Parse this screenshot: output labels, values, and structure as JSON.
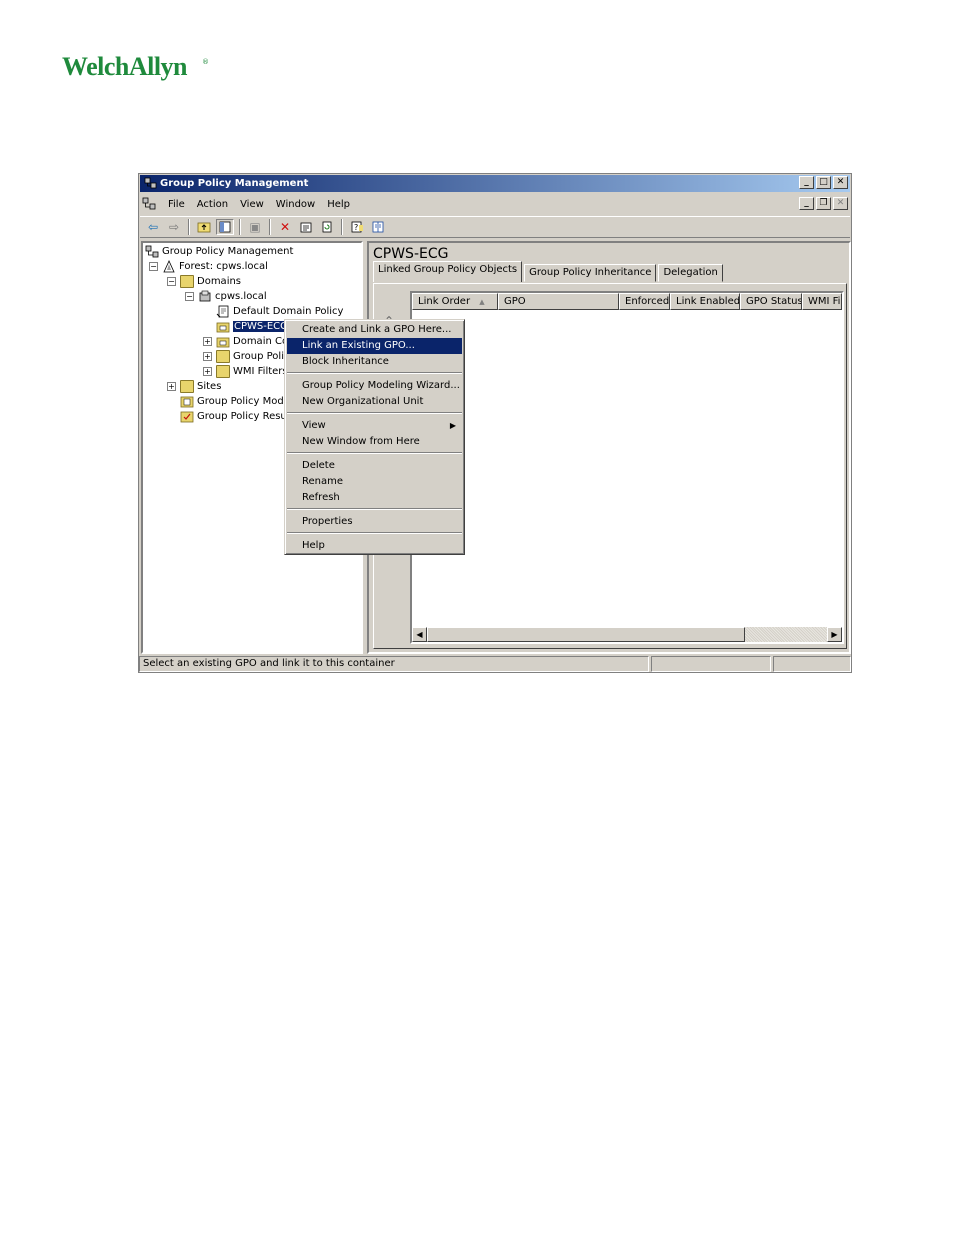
{
  "logo": {
    "text": "WelchAllyn",
    "reg": "®"
  },
  "window": {
    "title": "Group Policy Management",
    "menu": [
      "File",
      "Action",
      "View",
      "Window",
      "Help"
    ],
    "tree": {
      "root": "Group Policy Management",
      "forest": "Forest: cpws.local",
      "domains": "Domains",
      "domain": "cpws.local",
      "default_policy": "Default Domain Policy",
      "selected_ou": "CPWS-ECG",
      "domain_controllers": "Domain Con",
      "group_policy_objects": "Group Polic",
      "wmi_filters": "WMI Filters",
      "sites": "Sites",
      "modeling": "Group Policy Modeli",
      "results": "Group Policy Result"
    },
    "right": {
      "title": "CPWS-ECG",
      "tabs": [
        "Linked Group Policy Objects",
        "Group Policy Inheritance",
        "Delegation"
      ],
      "columns": [
        "Link Order",
        "GPO",
        "Enforced",
        "Link Enabled",
        "GPO Status",
        "WMI Filt"
      ]
    },
    "status": {
      "text": "Select an existing GPO and link it to this container"
    }
  },
  "context_menu": {
    "items": [
      "Create and Link a GPO Here...",
      "Link an Existing GPO...",
      "Block Inheritance",
      "Group Policy Modeling Wizard...",
      "New Organizational Unit",
      "View",
      "New Window from Here",
      "Delete",
      "Rename",
      "Refresh",
      "Properties",
      "Help"
    ],
    "highlighted_index": 1
  }
}
